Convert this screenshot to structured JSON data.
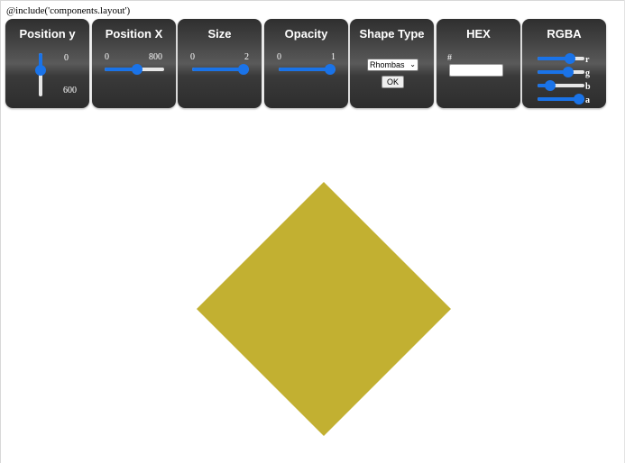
{
  "include_text": "@include('components.layout')",
  "panels": {
    "position_y": {
      "title": "Position y",
      "min_label": "0",
      "max_label": "600",
      "value_fraction": 0.35
    },
    "position_x": {
      "title": "Position X",
      "min_label": "0",
      "max_label": "800",
      "value_fraction": 0.55
    },
    "size": {
      "title": "Size",
      "min_label": "0",
      "max_label": "2",
      "value_fraction": 1.0
    },
    "opacity": {
      "title": "Opacity",
      "min_label": "0",
      "max_label": "1",
      "value_fraction": 1.0
    },
    "shape_type": {
      "title": "Shape Type",
      "selected": "Rhombas",
      "ok_label": "OK"
    },
    "hex": {
      "title": "HEX",
      "hash_label": "#",
      "value": ""
    },
    "rgba": {
      "title": "RGBA",
      "channels": [
        {
          "label": "r",
          "value_fraction": 0.75
        },
        {
          "label": "g",
          "value_fraction": 0.69
        },
        {
          "label": "b",
          "value_fraction": 0.2
        },
        {
          "label": "a",
          "value_fraction": 1.0
        }
      ]
    }
  },
  "shape": {
    "type": "rhombus",
    "color": "#c2b031"
  },
  "colors": {
    "accent": "#1a73e8",
    "panel_bg": "#3a3a3a"
  }
}
